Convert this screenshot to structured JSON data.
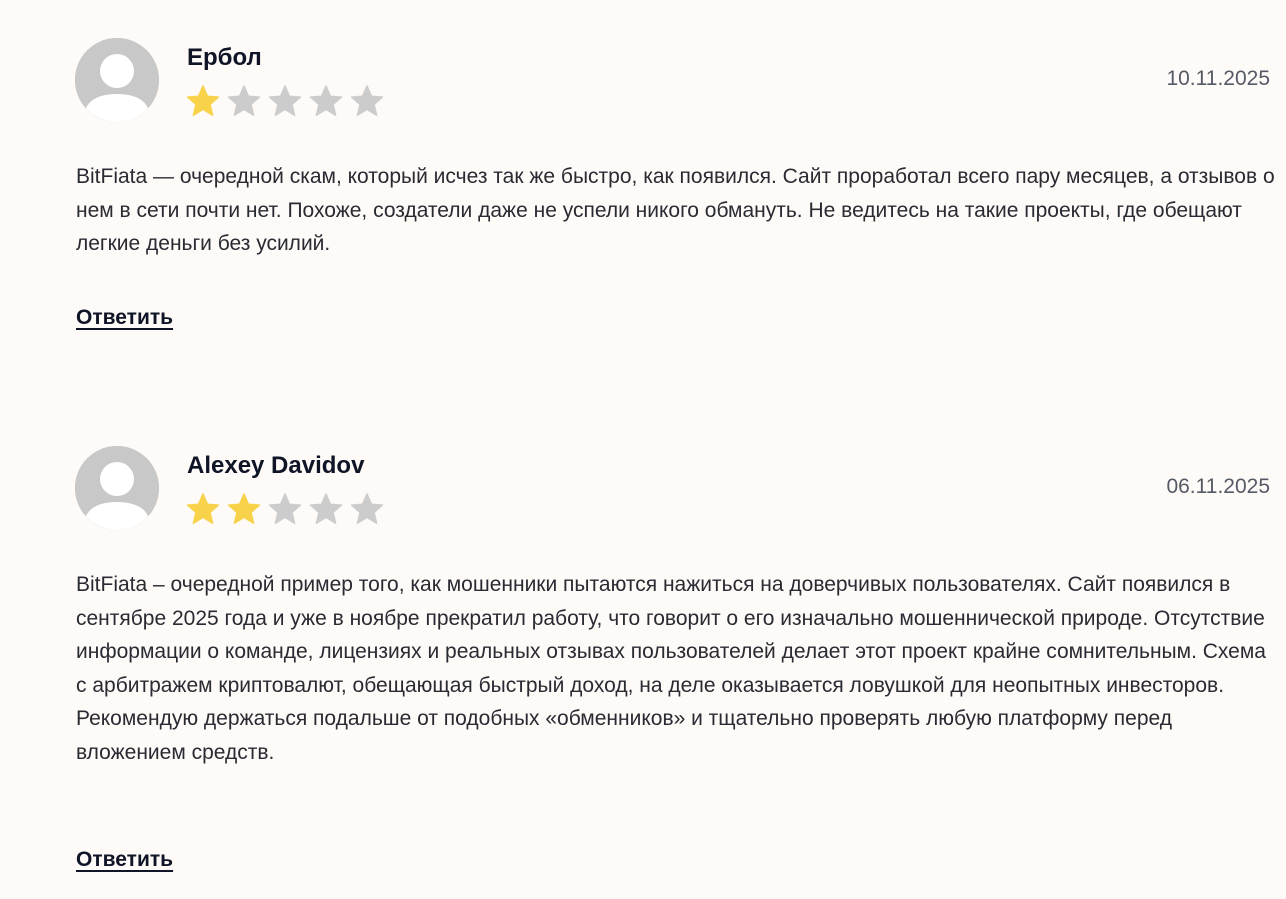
{
  "reviews": [
    {
      "author": "Ербол",
      "rating": 1,
      "max_rating": 5,
      "date": "10.11.2025",
      "text": "BitFiata — очередной скам, который исчез так же быстро, как появился. Сайт проработал всего пару месяцев, а отзывов о нем в сети почти нет. Похоже, создатели даже не успели никого обмануть. Не ведитесь на такие проекты, где обещают легкие деньги без усилий.",
      "reply_label": "Ответить"
    },
    {
      "author": "Alexey Davidov",
      "rating": 2,
      "max_rating": 5,
      "date": "06.11.2025",
      "text": "BitFiata – очередной пример того, как мошенники пытаются нажиться на доверчивых пользователях. Сайт появился в сентябре 2025 года и уже в ноябре прекратил работу, что говорит о его изначально мошеннической природе. Отсутствие информации о команде, лицензиях и реальных отзывах пользователей делает этот проект крайне сомнительным. Схема с арбитражем криптовалют, обещающая быстрый доход, на деле оказывается ловушкой для неопытных инвесторов. Рекомендую держаться подальше от подобных «обменников» и тщательно проверять любую платформу перед вложением средств.",
      "reply_label": "Ответить"
    }
  ],
  "colors": {
    "star_filled": "#f8d24a",
    "star_empty": "#cccccc",
    "avatar_bg": "#c8c8c8",
    "page_bg": "#fdfaf7"
  },
  "icons": {
    "avatar": "user-silhouette-icon",
    "star": "star-icon"
  }
}
